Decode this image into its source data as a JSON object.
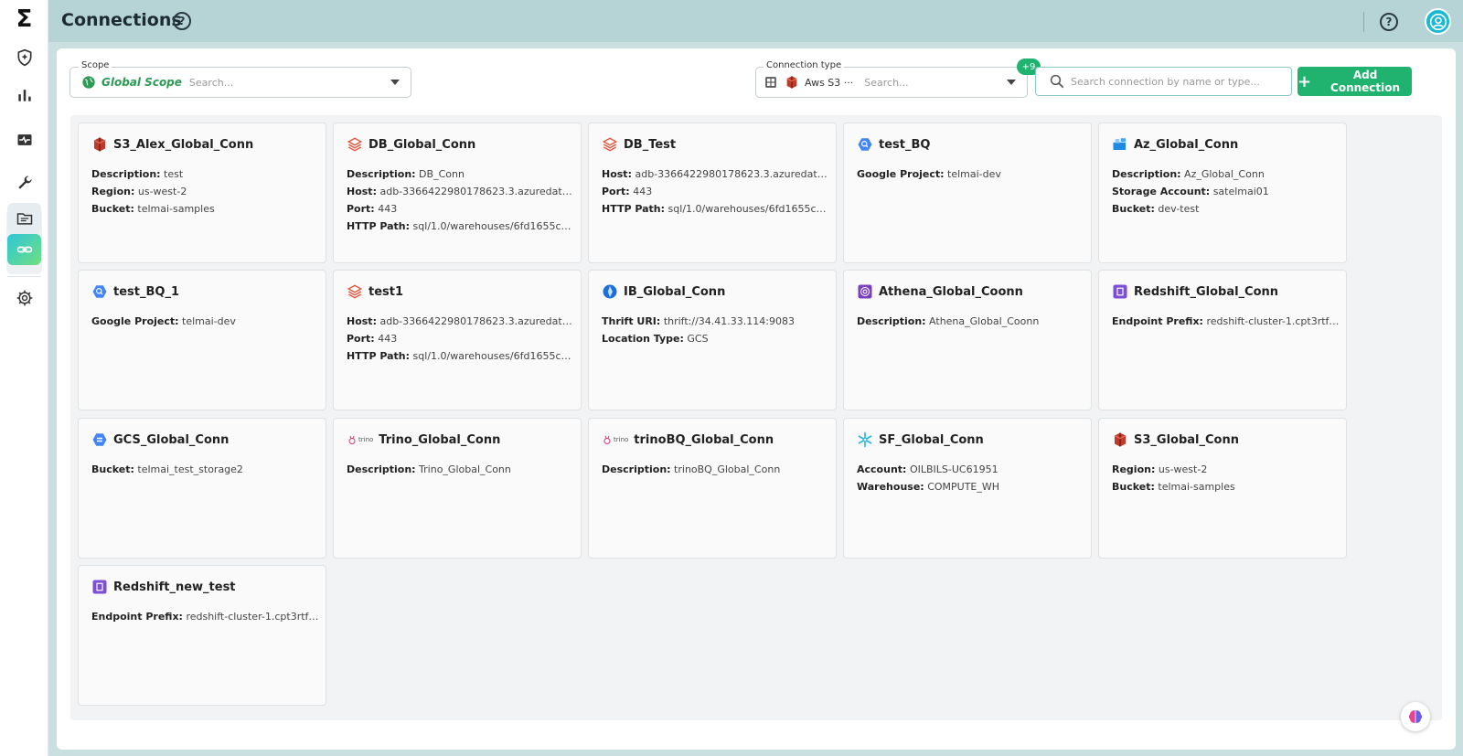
{
  "app": {
    "logo": "Σ",
    "page_title": "Connections",
    "help_glyph": "?"
  },
  "sidebar": {
    "items": [
      {
        "name": "shield-icon"
      },
      {
        "name": "bar-chart-icon"
      },
      {
        "name": "monitor-icon"
      },
      {
        "name": "wrench-icon"
      },
      {
        "name": "folder-icon"
      },
      {
        "name": "link-icon",
        "active": true
      },
      {
        "name": "gear-icon"
      }
    ]
  },
  "filters": {
    "scope_label": "Scope",
    "scope_value": "Global Scope",
    "scope_placeholder": "Search...",
    "conn_type_label": "Connection type",
    "conn_type_value": "Aws S3 ···",
    "conn_type_placeholder": "Search...",
    "conn_type_extra": "+9",
    "search_placeholder": "Search connection by name or type...",
    "add_label": "Add Connection"
  },
  "colors": {
    "accent_green": "#1fb36f",
    "header_bg": "#b6d4d6",
    "active_nav_gradient": "#2fc6d8"
  },
  "cards": [
    {
      "name": "S3_Alex_Global_Conn",
      "icon": "aws-s3-icon",
      "fields": [
        {
          "k": "Description:",
          "v": "test"
        },
        {
          "k": "Region:",
          "v": "us-west-2"
        },
        {
          "k": "Bucket:",
          "v": "telmai-samples"
        }
      ]
    },
    {
      "name": "DB_Global_Conn",
      "icon": "databricks-icon",
      "fields": [
        {
          "k": "Description:",
          "v": "DB_Conn"
        },
        {
          "k": "Host:",
          "v": "adb-3366422980178623.3.azuredatab..."
        },
        {
          "k": "Port:",
          "v": "443"
        },
        {
          "k": "HTTP Path:",
          "v": "sql/1.0/warehouses/6fd1655c35..."
        }
      ]
    },
    {
      "name": "DB_Test",
      "icon": "databricks-icon",
      "fields": [
        {
          "k": "Host:",
          "v": "adb-3366422980178623.3.azuredatab..."
        },
        {
          "k": "Port:",
          "v": "443"
        },
        {
          "k": "HTTP Path:",
          "v": "sql/1.0/warehouses/6fd1655c35..."
        }
      ]
    },
    {
      "name": "test_BQ",
      "icon": "bigquery-icon",
      "fields": [
        {
          "k": "Google Project:",
          "v": "telmai-dev"
        }
      ]
    },
    {
      "name": "Az_Global_Conn",
      "icon": "azure-storage-icon",
      "fields": [
        {
          "k": "Description:",
          "v": "Az_Global_Conn"
        },
        {
          "k": "Storage Account:",
          "v": "satelmai01"
        },
        {
          "k": "Bucket:",
          "v": "dev-test"
        }
      ]
    },
    {
      "name": "test_BQ_1",
      "icon": "bigquery-icon",
      "fields": [
        {
          "k": "Google Project:",
          "v": "telmai-dev"
        }
      ]
    },
    {
      "name": "test1",
      "icon": "databricks-icon",
      "fields": [
        {
          "k": "Host:",
          "v": "adb-3366422980178623.3.azuredatab..."
        },
        {
          "k": "Port:",
          "v": "443"
        },
        {
          "k": "HTTP Path:",
          "v": "sql/1.0/warehouses/6fd1655c35..."
        }
      ]
    },
    {
      "name": "IB_Global_Conn",
      "icon": "iceberg-icon",
      "fields": [
        {
          "k": "Thrift URI:",
          "v": "thrift://34.41.33.114:9083"
        },
        {
          "k": "Location Type:",
          "v": "GCS"
        }
      ]
    },
    {
      "name": "Athena_Global_Coonn",
      "icon": "athena-icon",
      "fields": [
        {
          "k": "Description:",
          "v": "Athena_Global_Coonn"
        }
      ]
    },
    {
      "name": "Redshift_Global_Conn",
      "icon": "redshift-icon",
      "fields": [
        {
          "k": "Endpoint Prefix:",
          "v": "redshift-cluster-1.cpt3rtf7dn..."
        }
      ]
    },
    {
      "name": "GCS_Global_Conn",
      "icon": "gcs-icon",
      "fields": [
        {
          "k": "Bucket:",
          "v": "telmai_test_storage2"
        }
      ]
    },
    {
      "name": "Trino_Global_Conn",
      "icon": "trino-icon",
      "icon_text": "trino",
      "fields": [
        {
          "k": "Description:",
          "v": "Trino_Global_Conn"
        }
      ]
    },
    {
      "name": "trinoBQ_Global_Conn",
      "icon": "trino-icon",
      "icon_text": "trino",
      "fields": [
        {
          "k": "Description:",
          "v": "trinoBQ_Global_Conn"
        }
      ]
    },
    {
      "name": "SF_Global_Conn",
      "icon": "snowflake-icon",
      "fields": [
        {
          "k": "Account:",
          "v": "OILBILS-UC61951"
        },
        {
          "k": "Warehouse:",
          "v": "COMPUTE_WH"
        }
      ]
    },
    {
      "name": "S3_Global_Conn",
      "icon": "aws-s3-icon",
      "fields": [
        {
          "k": "Region:",
          "v": "us-west-2"
        },
        {
          "k": "Bucket:",
          "v": "telmai-samples"
        }
      ]
    },
    {
      "name": "Redshift_new_test",
      "icon": "redshift-icon",
      "fields": [
        {
          "k": "Endpoint Prefix:",
          "v": "redshift-cluster-1.cpt3rtf7dn..."
        }
      ]
    }
  ]
}
